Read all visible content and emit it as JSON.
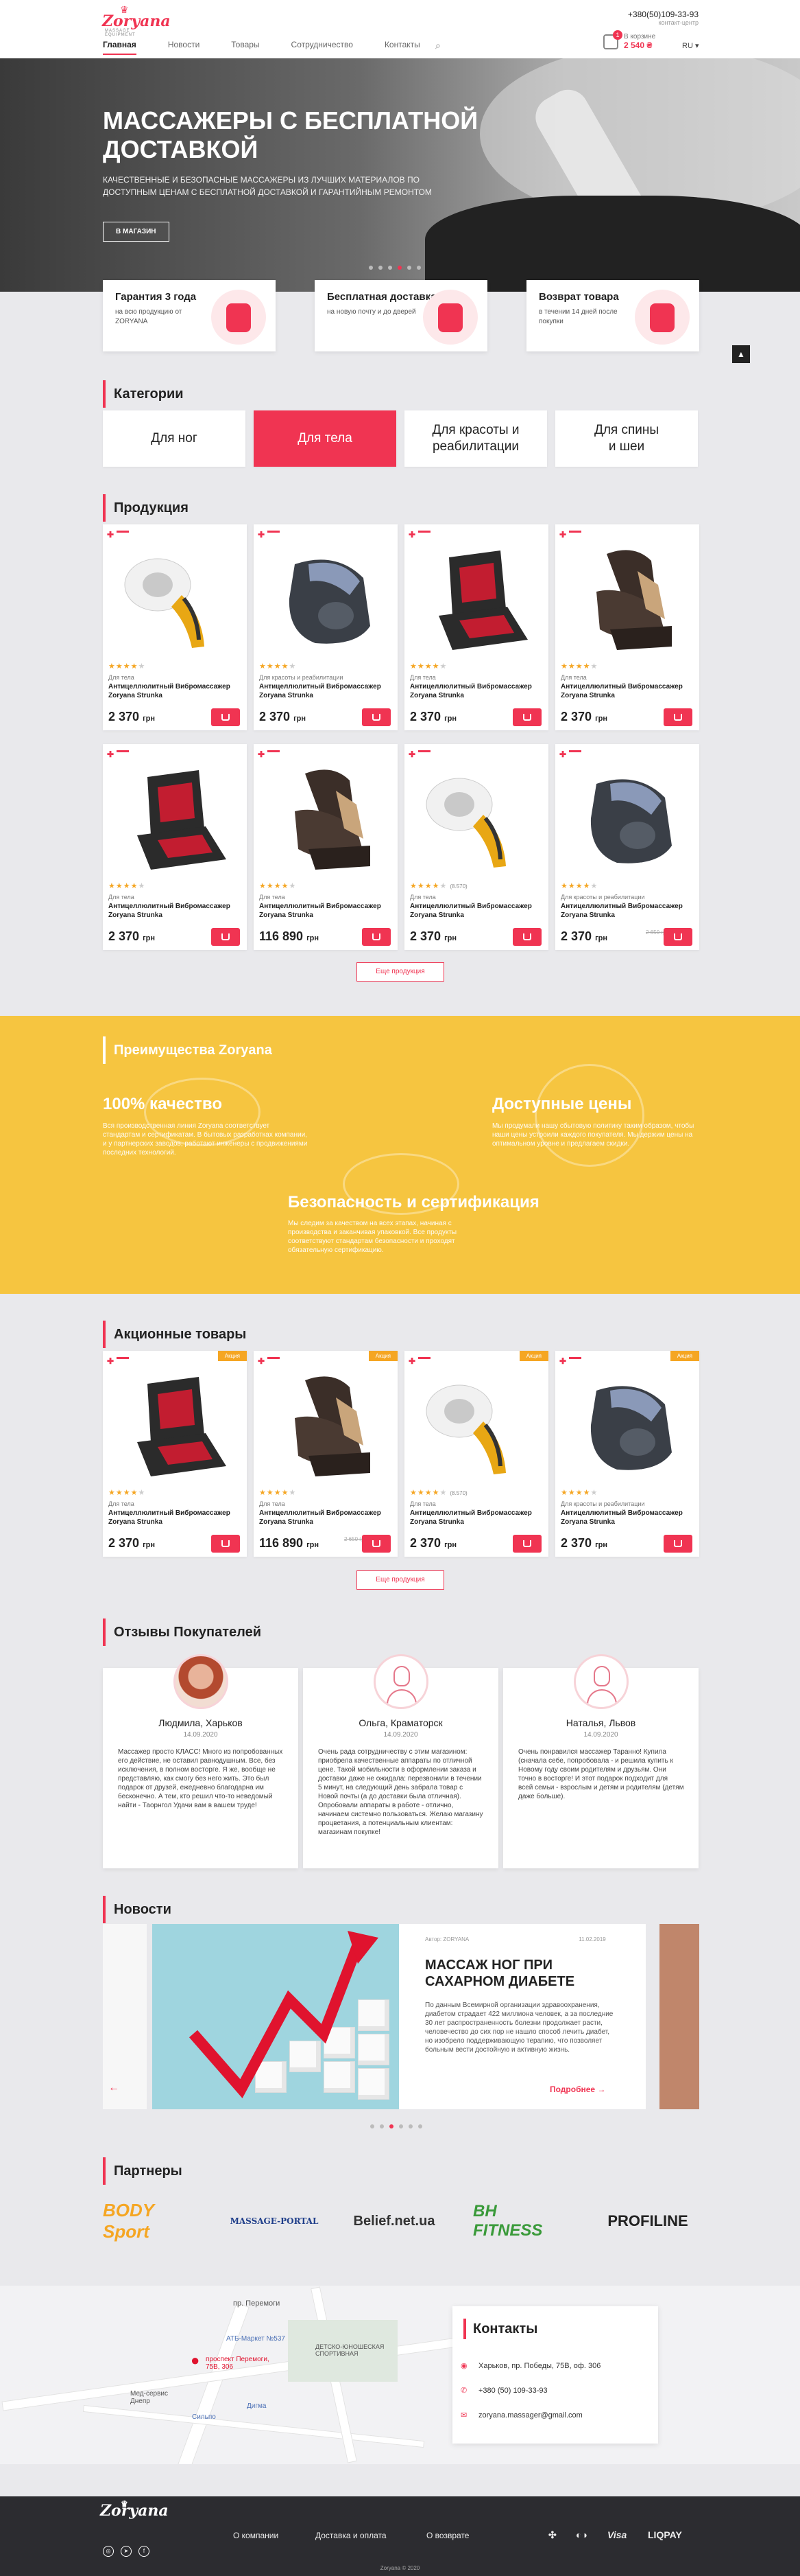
{
  "header": {
    "logo_text": "Zoryana",
    "logo_sub": "MASSAGE EQUIPMENT",
    "nav": [
      "Главная",
      "Новости",
      "Товары",
      "Сотрудничество",
      "Контакты"
    ],
    "phone": "+380(50)109-33-93",
    "phone_sub": "контакт-центр",
    "cart_label": "В корзине",
    "cart_total": "2 540 ₴",
    "cart_count": "1",
    "lang": "RU"
  },
  "hero": {
    "title": "МАССАЖЕРЫ С БЕСПЛАТНОЙ ДОСТАВКОЙ",
    "text": "КАЧЕСТВЕННЫЕ И БЕЗОПАСНЫЕ МАССАЖЕРЫ ИЗ ЛУЧШИХ МАТЕРИАЛОВ ПО ДОСТУПНЫМ ЦЕНАМ С БЕСПЛАТНОЙ ДОСТАВКОЙ И ГАРАНТИЙНЫМ РЕМОНТОМ",
    "button": "В МАГАЗИН"
  },
  "features": [
    {
      "title": "Гарантия 3 года",
      "text": "на всю продукцию от ZORYANA"
    },
    {
      "title": "Бесплатная доставка",
      "text": "на новую почту и до дверей"
    },
    {
      "title": "Возврат товара",
      "text": "в течении 14 дней после покупки"
    }
  ],
  "categories": {
    "title": "Категории",
    "items": [
      "Для ног",
      "Для тела",
      "Для красоты и реабилитации",
      "Для спины и шеи"
    ]
  },
  "products": {
    "title": "Продукция",
    "more": "Еще продукция",
    "items": [
      {
        "cat": "Для тела",
        "name": "Антицеллюлитный Вибромассажер Zoryana Strunka",
        "price": "2 370",
        "currency": "грн",
        "rating": 4,
        "reviews": "",
        "old": "",
        "type": "handheld"
      },
      {
        "cat": "Для красоты и реабилитации",
        "name": "Антицеллюлитный Вибромассажер Zoryana Strunka",
        "price": "2 370",
        "currency": "грн",
        "rating": 4,
        "reviews": "",
        "old": "",
        "type": "foot"
      },
      {
        "cat": "Для тела",
        "name": "Антицеллюлитный Вибромассажер Zoryana Strunka",
        "price": "2 370",
        "currency": "грн",
        "rating": 4,
        "reviews": "",
        "old": "",
        "type": "seat"
      },
      {
        "cat": "Для тела",
        "name": "Антицеллюлитный Вибромассажер Zoryana Strunka",
        "price": "2 370",
        "currency": "грн",
        "rating": 4,
        "reviews": "",
        "old": "",
        "type": "chair"
      },
      {
        "cat": "Для тела",
        "name": "Антицеллюлитный Вибромассажер Zoryana Strunka",
        "price": "2 370",
        "currency": "грн",
        "rating": 4,
        "reviews": "",
        "old": "",
        "type": "seat"
      },
      {
        "cat": "Для тела",
        "name": "Антицеллюлитный Вибромассажер Zoryana Strunka",
        "price": "116 890",
        "currency": "грн",
        "rating": 4,
        "reviews": "",
        "old": "",
        "type": "chair"
      },
      {
        "cat": "Для тела",
        "name": "Антицеллюлитный Вибромассажер Zoryana Strunka",
        "price": "2 370",
        "currency": "грн",
        "rating": 4,
        "reviews": "(8.570)",
        "old": "",
        "type": "handheld"
      },
      {
        "cat": "Для красоты и реабилитации",
        "name": "Антицеллюлитный Вибромассажер Zoryana Strunka",
        "price": "2 370",
        "currency": "грн",
        "rating": 4,
        "reviews": "",
        "old": "2 650 грн",
        "type": "foot"
      }
    ]
  },
  "advantages": {
    "title": "Преимущества Zoryana",
    "items": [
      {
        "title": "100% качество",
        "text": "Вся производственная линия Zoryana соответствует стандартам и сертификатам. В бытовых разработках компании, и у партнерских заводов, работают инженеры с продвижениями последних технологий."
      },
      {
        "title": "Доступные цены",
        "text": "Мы продумали нашу сбытовую политику таким образом, чтобы наши цены устроили каждого покупателя. Мы держим цены на оптимальном уровне и предлагаем скидки."
      },
      {
        "title": "Безопасность и сертификация",
        "text": "Мы следим за качеством на всех этапах, начиная с производства и заканчивая упаковкой. Все продукты соответствуют стандартам безопасности и проходят обязательную сертификацию."
      }
    ]
  },
  "promo": {
    "title": "Акционные товары",
    "more": "Еще продукция",
    "sale_label": "Акция",
    "items": [
      {
        "cat": "Для тела",
        "name": "Антицеллюлитный Вибромассажер Zoryana Strunka",
        "price": "2 370",
        "currency": "грн",
        "rating": 4,
        "reviews": "",
        "old": "",
        "type": "seat"
      },
      {
        "cat": "Для тела",
        "name": "Антицеллюлитный Вибромассажер Zoryana Strunka",
        "price": "116 890",
        "currency": "грн",
        "rating": 4,
        "reviews": "",
        "old": "2 650 грн",
        "type": "chair"
      },
      {
        "cat": "Для тела",
        "name": "Антицеллюлитный Вибромассажер Zoryana Strunka",
        "price": "2 370",
        "currency": "грн",
        "rating": 4,
        "reviews": "(8.570)",
        "old": "",
        "type": "handheld"
      },
      {
        "cat": "Для красоты и реабилитации",
        "name": "Антицеллюлитный Вибромассажер Zoryana Strunka",
        "price": "2 370",
        "currency": "грн",
        "rating": 4,
        "reviews": "",
        "old": "",
        "type": "foot"
      }
    ]
  },
  "reviews": {
    "title": "Отзывы Покупателей",
    "items": [
      {
        "name": "Людмила, Харьков",
        "date": "14.09.2020",
        "text": "Массажер просто КЛАСС! Много из попробованных его действие, не оставил равнодушным. Все, без исключения, в полном восторге. Я же, вообще не представляю, как смогу без него жить. Это был подарок от друзей, ежедневно благодарна им бесконечно. А тем, кто решил что-то неведомый найти - Таорнгол Удачи вам в вашем труде!",
        "avatar": "photo"
      },
      {
        "name": "Ольга, Краматорск",
        "date": "14.09.2020",
        "text": "Очень рада сотрудничеству с этим магазином: приобрела качественные аппараты по отличной цене. Такой мобильности в оформлении заказа и доставки даже не ожидала: перезвонили в течении 5 минут, на следующий день забрала товар с Новой почты (а до доставки была отличная). Опробовали аппараты в работе - отлично, начинаем системно пользоваться. Желаю магазину процветания, а потенциальным клиентам: магазинам покупке!",
        "avatar": "icon"
      },
      {
        "name": "Наталья, Львов",
        "date": "14.09.2020",
        "text": "Очень понравился массажер Таранно! Купила (сначала себе, попробовала - и решила купить к Новому году своим родителям и друзьям. Они точно в восторге! И этот подарок подходит для всей семьи - взрослым и детям и родителям (детям даже больше).",
        "avatar": "icon"
      }
    ]
  },
  "news": {
    "title": "Новости",
    "author": "Автор: ZORYANA",
    "date": "11.02.2019",
    "headline": "МАССАЖ НОГ ПРИ САХАРНОМ ДИАБЕТЕ",
    "text": "По данным Всемирной организации здравоохранения, диабетом страдает 422 миллиона человек, а за последние 30 лет распространенность болезни продолжает расти, человечество до сих пор не нашло способ лечить диабет, но изобрело поддерживающую терапию, что позволяет больным вести достойную и активную жизнь.",
    "more": "Подробнее"
  },
  "partners": {
    "title": "Партнеры",
    "items": [
      {
        "name": "BODY Sport",
        "color": "#f5a623"
      },
      {
        "name": "MASSAGE-PORTAL",
        "color": "#1f3e8a"
      },
      {
        "name": "Belief.net.ua",
        "color": "#333333"
      },
      {
        "name": "BH FITNESS",
        "color": "#3a9a3a"
      },
      {
        "name": "PROFILINE",
        "color": "#222222"
      }
    ]
  },
  "map": {
    "labels": [
      "пр. Перемоги",
      "АТБ-Маркет №537",
      "ДЕТСКО-ЮНОШЕСКАЯ СПОРТИВНАЯ",
      "Мед-сервис Днепр",
      "Сильпо",
      "Дигма"
    ],
    "pin_label": "проспект Перемоги, 75В, 306"
  },
  "contacts": {
    "title": "Контакты",
    "address": "Харьков, пр. Победы, 75В, оф. 306",
    "phone": "+380 (50) 109-33-93",
    "email": "zoryana.massager@gmail.com"
  },
  "footer": {
    "links": [
      "О компании",
      "Доставка и оплата",
      "О возврате"
    ],
    "social": [
      "instagram-icon",
      "telegram-icon",
      "facebook-icon"
    ],
    "payments": [
      "Visa",
      "LIQPAY"
    ],
    "copyright": "Zoryana © 2020"
  },
  "colors": {
    "accent": "#f03452",
    "yellow": "#f6c540",
    "dark": "#2c2c30"
  }
}
